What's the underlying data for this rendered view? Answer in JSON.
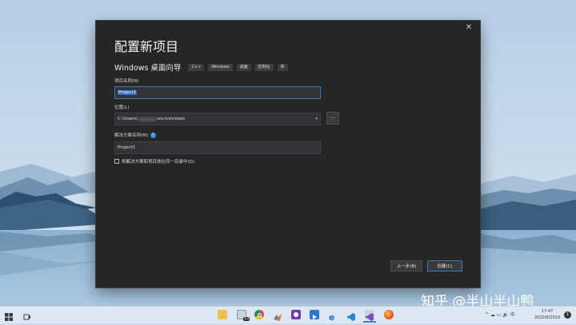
{
  "dialog": {
    "close": "✕",
    "title": "配置新项目",
    "template_name": "Windows 桌面向导",
    "tags": [
      "C++",
      "Windows",
      "桌面",
      "控制台",
      "库"
    ],
    "project_name_label": "项目名称(N)",
    "project_name_value": "Project1",
    "location_label": "位置(L)",
    "location_prefix": "C:\\Users\\",
    "location_suffix": "source\\repos",
    "browse": "...",
    "solution_name_label": "解决方案名称(M)",
    "solution_name_value": "Project1",
    "same_dir_label": "将解决方案和项目放在同一目录中(D)",
    "back_button": "上一步(B)",
    "create_button": "创建(C)"
  },
  "watermark": "知乎 @半山半山鸭",
  "taskbar": {
    "start_icon": "windows-logo-icon",
    "task_view_icon": "task-view-icon",
    "badge": "13",
    "apps": [
      "file-explorer-icon",
      "mail-icon",
      "chrome-icon",
      "matlab-icon",
      "github-desktop-icon",
      "app-icon",
      "edge-icon",
      "vscode-icon",
      "visual-studio-icon",
      "firefox-icon"
    ],
    "tray": "^ ☁ ▭ 🔊 中",
    "clock_time": "17:47",
    "clock_date": "2020/9/2019",
    "notifications": "1"
  },
  "colors": {
    "dialog_bg": "#262626",
    "accent": "#3c74b8",
    "taskbar_bg": "#dde7f1"
  }
}
